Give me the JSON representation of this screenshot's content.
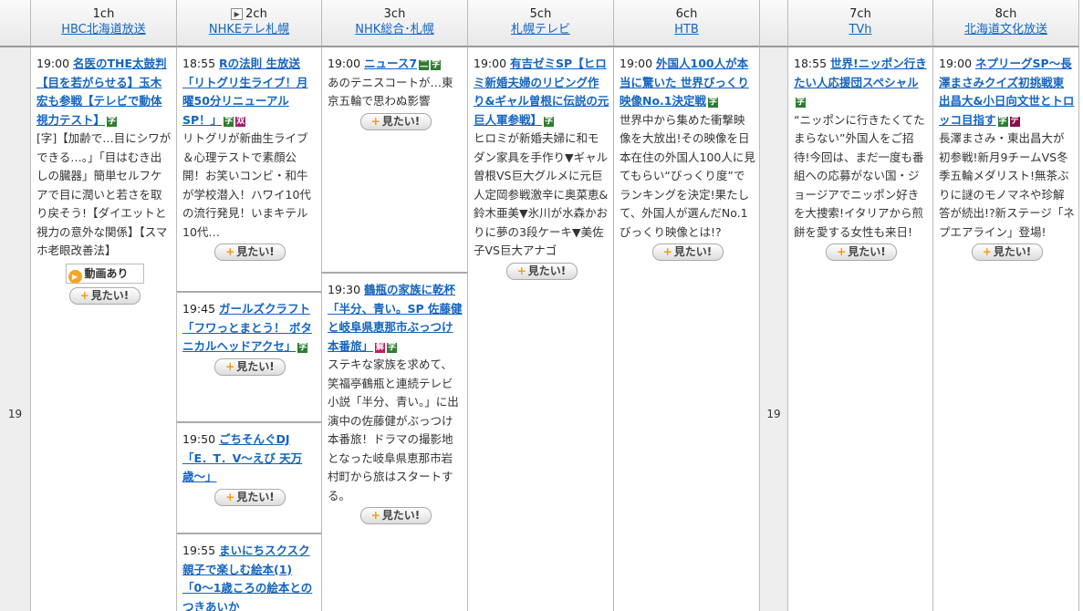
{
  "channels": [
    {
      "num": "1ch",
      "name": "HBC北海道放送"
    },
    {
      "num": "2ch",
      "name": "NHKEテレ札幌"
    },
    {
      "num": "3ch",
      "name": "NHK総合･札幌"
    },
    {
      "num": "5ch",
      "name": "札幌テレビ"
    },
    {
      "num": "6ch",
      "name": "HTB"
    },
    {
      "num": "7ch",
      "name": "TVh"
    },
    {
      "num": "8ch",
      "name": "北海道文化放送"
    }
  ],
  "hour_label": "19",
  "want_label": "見たい!",
  "video_label": "動画あり",
  "programs": {
    "ch1": [
      {
        "time": "19:00",
        "title": "名医のTHE太鼓判【目を若がらせる】玉木宏も参戦【テレビで動体視力テスト】",
        "desc": "[字]【加齢で…目にシワができる…。」「目はむき出しの臓器」簡単セルフケアで目に潤いと若さを取り戻そう!【ダイエットと視力の意外な関係】【スマホ老眼改善法】"
      }
    ],
    "ch2": [
      {
        "time": "18:55",
        "title": "Rの法則 生放送「リトグリ生ライブ！月曜50分リニューアルSP！」",
        "desc": "リトグリが新曲生ライブ＆心理テストで素顔公開！お笑いコンビ・和牛が学校潜入！ハワイ10代の流行発見！いまキテル10代…"
      },
      {
        "time": "19:45",
        "title": "ガールズクラフト「フワっとまとう！ ボタニカルヘッドアクセ」",
        "desc": ""
      },
      {
        "time": "19:50",
        "title": "ごちそんぐDJ「E．T．V〜えび 天万歳〜」",
        "desc": ""
      },
      {
        "time": "19:55",
        "title": "まいにちスクスク 親子で楽しむ絵本(1)「0〜1歳ころの絵本とのつきあいか",
        "desc": ""
      }
    ],
    "ch3": [
      {
        "time": "19:00",
        "title": "ニュース7",
        "desc": "あのテニスコートが…東京五輪で思わぬ影響"
      },
      {
        "time": "19:30",
        "title": "鶴瓶の家族に乾杯「半分、青い。SP 佐藤健と岐阜県恵那市ぶっつけ本番旅」",
        "desc": "ステキな家族を求めて、笑福亭鶴瓶と連続テレビ小説「半分、青い。」に出演中の佐藤健がぶっつけ本番旅！ドラマの撮影地となった岐阜県恵那市岩村町から旅はスタートする。"
      }
    ],
    "ch5": [
      {
        "time": "19:00",
        "title": "有吉ゼミSP【ヒロミ新婚夫婦のリビング作り&ギャル曽根に伝説の元巨人軍参戦】",
        "desc": "ヒロミが新婚夫婦に和モダン家具を手作り▼ギャル曽根VS巨大グルメに元巨人定岡参戦激辛に奥菜恵&鈴木亜美▼氷川が水森かおりに夢の3段ケーキ▼美佐子VS巨大アナゴ"
      }
    ],
    "ch6": [
      {
        "time": "19:00",
        "title": "外国人100人が本当に驚いた 世界びっくり映像No.1決定戦",
        "desc": "世界中から集めた衝撃映像を大放出!その映像を日本在住の外国人100人に見てもらい“びっくり度”でランキングを決定!果たして、外国人が選んだNo.1びっくり映像とは!?"
      }
    ],
    "ch7": [
      {
        "time": "18:55",
        "title": "世界!ニッポン行きたい人応援団スペシャル",
        "desc": "“ニッポンに行きたくてたまらない”外国人をご招待!今回は、まだ一度も番組への応募がない国・ジョージアでニッポン好きを大捜索!イタリアから煎餅を愛する女性も来日!"
      }
    ],
    "ch8": [
      {
        "time": "19:00",
        "title": "ネプリーグSP〜長澤まさみクイズ初挑戦東出昌大&小日向文世とトロッコ目指す",
        "desc": "長澤まさみ・東出昌大が初参戦!新月9チームVS冬季五輪メダリスト!無茶ぶりに謎のモノマネや珍解答が続出!?新ステージ「ネプエアライン」登場!"
      }
    ]
  },
  "badges": {
    "ji": "字",
    "sou": "双",
    "fuki": "解",
    "de": "デ"
  },
  "icons": {
    "play": "play-icon",
    "video": "video-icon",
    "plus": "plus-icon"
  }
}
